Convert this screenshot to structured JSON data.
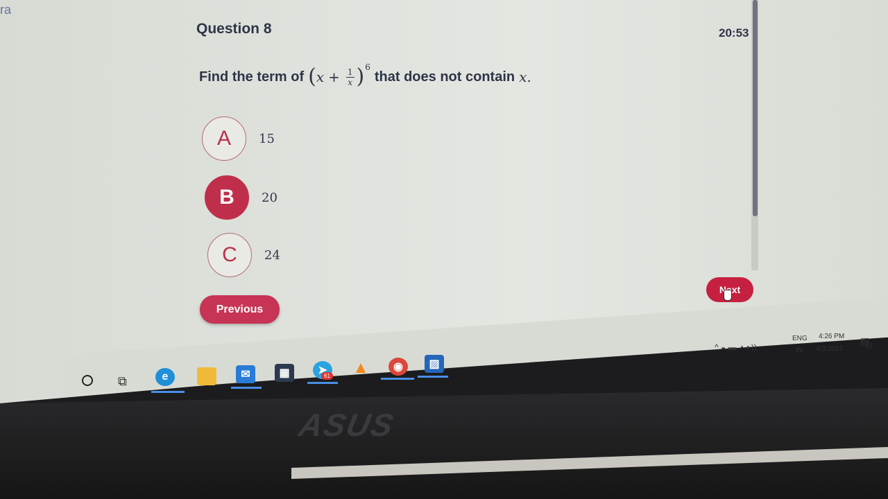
{
  "corner_text": "ra",
  "quiz": {
    "title": "Question 8",
    "timer": "20:53",
    "question": {
      "prefix": "Find the term of",
      "numerator": "1",
      "denominator": "x",
      "exponent": "6",
      "suffix": "that does not contain",
      "variable": "x."
    },
    "options": [
      {
        "letter": "A",
        "value": "15",
        "selected": false
      },
      {
        "letter": "B",
        "value": "20",
        "selected": true
      },
      {
        "letter": "C",
        "value": "24",
        "selected": false
      }
    ],
    "previous_label": "Previous",
    "next_label": "Next"
  },
  "taskbar": {
    "apps": [
      "search-icon",
      "task-view-icon",
      "edge-icon",
      "file-explorer-icon",
      "mail-icon",
      "store-icon",
      "telegram-icon",
      "vlc-icon",
      "chrome-icon",
      "photos-icon"
    ],
    "telegram_badge": "61",
    "tray": {
      "lang": "ENG",
      "region": "IN",
      "time": "4:26 PM",
      "date": "4/3/2021",
      "notifications": "22"
    }
  },
  "laptop_brand": "ASUS"
}
